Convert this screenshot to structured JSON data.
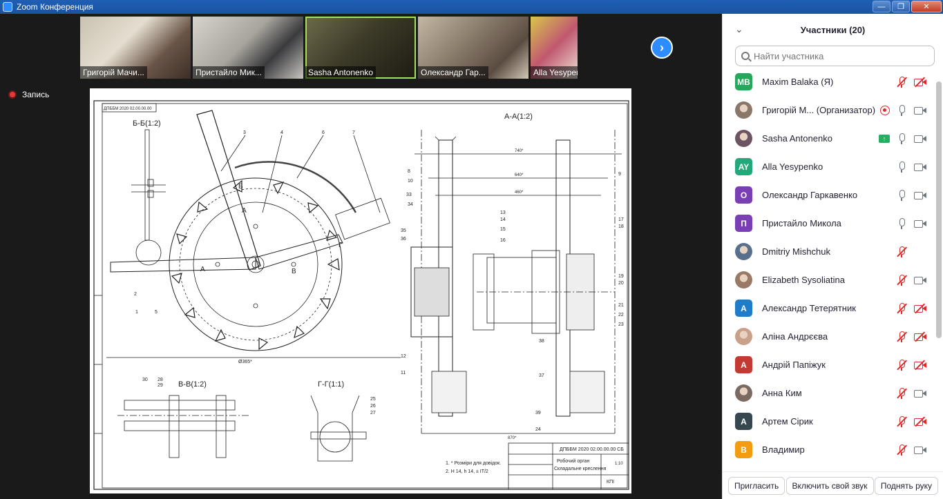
{
  "window": {
    "title": "Zoom Конференция"
  },
  "video_strip": {
    "thumbnails": [
      {
        "name": "Григорій Мачи...",
        "active": false
      },
      {
        "name": "Пристайло Мик...",
        "active": false
      },
      {
        "name": "Sasha Antonenko",
        "active": true
      },
      {
        "name": "Олександр Гар...",
        "active": false
      },
      {
        "name": "Alla Yesypenko",
        "active": false
      }
    ]
  },
  "recording": {
    "label": "Запись"
  },
  "drawing": {
    "stamp_code": "ДПББМ 2020 02.00.00.00 СБ",
    "corner_code": "ДПББМ 2020 02.00.00.00",
    "title_line1": "Робочий орган",
    "title_line2": "Складальне креслення",
    "org": "КПІ",
    "sheet": "1:10",
    "note1": "1. * Розміри для довідок.",
    "note2": "2. H 14, h 14, ± IT/2",
    "section_bb": "Б-Б(1:2)",
    "section_aa": "А-А(1:2)",
    "section_vv": "В-В(1:2)",
    "section_gg": "Г-Г(1:1)",
    "dim_main": "Ø365*",
    "dim_aa_top": "740*",
    "dim_aa_mid": "640*",
    "dim_aa_low": "460*",
    "dim_aa_bottom": "870*",
    "leader_numbers_left": [
      "3",
      "4",
      "6",
      "7",
      "2",
      "1",
      "5"
    ],
    "leader_numbers_right": [
      "8",
      "10",
      "33",
      "34",
      "35",
      "36",
      "13",
      "14",
      "15",
      "16",
      "9",
      "17",
      "18",
      "19",
      "20",
      "21",
      "22",
      "23",
      "37",
      "38",
      "39",
      "24",
      "11",
      "12"
    ],
    "leader_numbers_bottom": [
      "30",
      "28",
      "29",
      "25",
      "26",
      "27"
    ]
  },
  "participants_panel": {
    "title": "Участники (20)",
    "search_placeholder": "Найти участника",
    "participants": [
      {
        "initials": "MB",
        "name": "Maxim Balaka (Я)",
        "color": "#23a85c",
        "photo": false,
        "mic": "muted",
        "cam": "off",
        "extra": ""
      },
      {
        "initials": "",
        "name": "Григорій М...  (Организатор)",
        "color": "#8a7768",
        "photo": true,
        "mic": "on",
        "cam": "on",
        "extra": "rec"
      },
      {
        "initials": "",
        "name": "Sasha Antonenko",
        "color": "#6d5463",
        "photo": true,
        "mic": "on",
        "cam": "on",
        "extra": "share"
      },
      {
        "initials": "AY",
        "name": "Alla Yesypenko",
        "color": "#23a87a",
        "photo": false,
        "mic": "on",
        "cam": "on",
        "extra": ""
      },
      {
        "initials": "О",
        "name": "Олександр Гаркавенко",
        "color": "#7b3fb5",
        "photo": false,
        "mic": "on",
        "cam": "on",
        "extra": ""
      },
      {
        "initials": "П",
        "name": "Пристайло Микола",
        "color": "#7b3fb5",
        "photo": false,
        "mic": "on",
        "cam": "on",
        "extra": ""
      },
      {
        "initials": "",
        "name": "Dmitriy Mishchuk",
        "color": "#58708a",
        "photo": true,
        "mic": "muted",
        "cam": "none",
        "extra": ""
      },
      {
        "initials": "",
        "name": "Elizabeth Sysoliatina",
        "color": "#9a7a66",
        "photo": true,
        "mic": "muted",
        "cam": "on",
        "extra": ""
      },
      {
        "initials": "А",
        "name": "Александр Тетерятник",
        "color": "#1f7cc9",
        "photo": false,
        "mic": "muted",
        "cam": "off",
        "extra": ""
      },
      {
        "initials": "",
        "name": "Аліна Андрєєва",
        "color": "#c9a08a",
        "photo": true,
        "mic": "muted",
        "cam": "off",
        "extra": ""
      },
      {
        "initials": "А",
        "name": "Андрій Папіжук",
        "color": "#c23a32",
        "photo": false,
        "mic": "muted",
        "cam": "off",
        "extra": ""
      },
      {
        "initials": "",
        "name": "Анна Ким",
        "color": "#7a6a62",
        "photo": true,
        "mic": "muted",
        "cam": "on",
        "extra": ""
      },
      {
        "initials": "А",
        "name": "Артем Сірик",
        "color": "#37474f",
        "photo": false,
        "mic": "muted",
        "cam": "off",
        "extra": ""
      },
      {
        "initials": "В",
        "name": "Владимир",
        "color": "#f39c12",
        "photo": false,
        "mic": "muted",
        "cam": "on",
        "extra": ""
      }
    ],
    "footer": {
      "invite": "Пригласить",
      "unmute": "Включить свой звук",
      "raise_hand": "Поднять руку"
    }
  }
}
